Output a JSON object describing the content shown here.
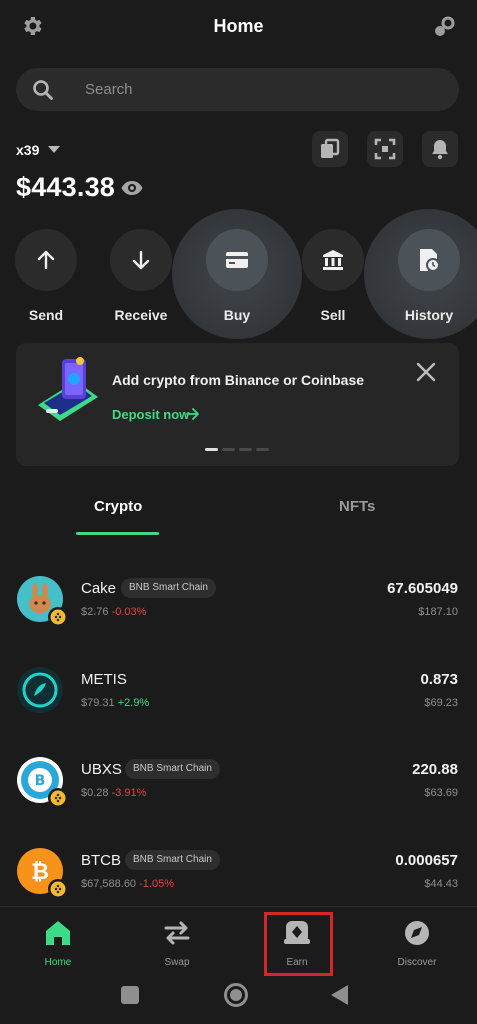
{
  "header": {
    "title": "Home",
    "settings_icon": "gear-icon",
    "connect_icon": "link-icon"
  },
  "search": {
    "placeholder": "Search"
  },
  "wallet": {
    "name": "x39",
    "balance": "$443.38"
  },
  "actions": [
    {
      "label": "Send",
      "icon": "arrow-up-icon"
    },
    {
      "label": "Receive",
      "icon": "arrow-down-icon"
    },
    {
      "label": "Buy",
      "icon": "card-icon"
    },
    {
      "label": "Sell",
      "icon": "bank-icon"
    },
    {
      "label": "History",
      "icon": "history-icon"
    }
  ],
  "banner": {
    "title": "Add crypto from Binance or Coinbase",
    "cta": "Deposit now"
  },
  "tabs": [
    {
      "label": "Crypto"
    },
    {
      "label": "NFTs"
    }
  ],
  "assets": [
    {
      "symbol": "Cake",
      "network": "BNB Smart Chain",
      "price": "$2.76",
      "change": "-0.03%",
      "amount": "67.605049",
      "value": "$187.10"
    },
    {
      "symbol": "METIS",
      "network": "",
      "price": "$79.31",
      "change": "+2.9%",
      "amount": "0.873",
      "value": "$69.23"
    },
    {
      "symbol": "UBXS",
      "network": "BNB Smart Chain",
      "price": "$0.28",
      "change": "-3.91%",
      "amount": "220.88",
      "value": "$63.69"
    },
    {
      "symbol": "BTCB",
      "network": "BNB Smart Chain",
      "price": "$67,588.60",
      "change": "-1.05%",
      "amount": "0.000657",
      "value": "$44.43"
    }
  ],
  "bottom_nav": [
    {
      "label": "Home"
    },
    {
      "label": "Swap"
    },
    {
      "label": "Earn"
    },
    {
      "label": "Discover"
    }
  ],
  "colors": {
    "background": "#1b1b1b",
    "accent_green": "#3ddb85",
    "negative_red": "#e2463f",
    "highlight_red": "#d8252a"
  }
}
